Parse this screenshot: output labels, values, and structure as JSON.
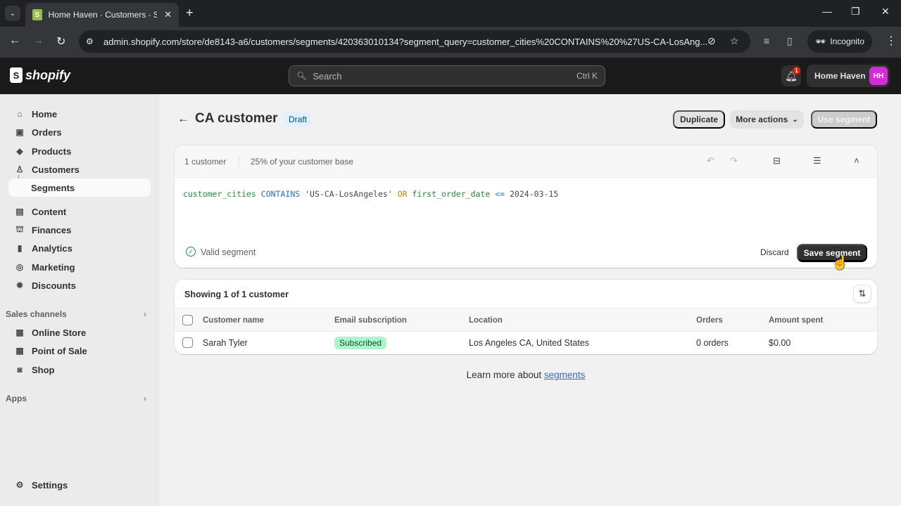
{
  "browser": {
    "tab_title": "Home Haven · Customers · Shopify",
    "url": "admin.shopify.com/store/de8143-a6/customers/segments/420363010134?segment_query=customer_cities%20CONTAINS%20%27US-CA-LosAng...",
    "incognito_label": "Incognito",
    "new_tab": "+",
    "tab_close": "✕"
  },
  "header": {
    "logo_text": "shopify",
    "search_placeholder": "Search",
    "search_shortcut": "Ctrl K",
    "notification_count": "1",
    "store_name": "Home Haven",
    "avatar_initials": "HH",
    "avatar_color": "#d42cd6"
  },
  "sidebar": {
    "items": [
      {
        "label": "Home",
        "icon": "home-icon"
      },
      {
        "label": "Orders",
        "icon": "inbox-icon"
      },
      {
        "label": "Products",
        "icon": "tag-icon"
      },
      {
        "label": "Customers",
        "icon": "person-icon"
      },
      {
        "label": "Segments",
        "icon": "",
        "active": true
      },
      {
        "label": "Content",
        "icon": "content-icon"
      },
      {
        "label": "Finances",
        "icon": "bank-icon"
      },
      {
        "label": "Analytics",
        "icon": "bar-chart-icon"
      },
      {
        "label": "Marketing",
        "icon": "target-icon"
      },
      {
        "label": "Discounts",
        "icon": "discount-icon"
      }
    ],
    "sales_channels_label": "Sales channels",
    "sales_channels": [
      {
        "label": "Online Store",
        "icon": "store-icon"
      },
      {
        "label": "Point of Sale",
        "icon": "pos-icon"
      },
      {
        "label": "Shop",
        "icon": "shop-icon"
      }
    ],
    "apps_label": "Apps",
    "settings_label": "Settings"
  },
  "page": {
    "title": "CA customer",
    "status_badge": "Draft",
    "actions": {
      "duplicate": "Duplicate",
      "more_actions": "More actions",
      "use_segment": "Use segment"
    }
  },
  "editor": {
    "customer_count": "1 customer",
    "base_percentage": "25% of your customer base",
    "query": {
      "field1": "customer_cities",
      "op1": "CONTAINS",
      "value1": "'US-CA-LosAngeles'",
      "logic": "OR",
      "field2": "first_order_date",
      "op2": "<=",
      "value2": "2024-03-15"
    },
    "validation": "Valid segment",
    "discard_label": "Discard",
    "save_label": "Save segment"
  },
  "results": {
    "summary": "Showing 1 of 1 customer",
    "columns": [
      "Customer name",
      "Email subscription",
      "Location",
      "Orders",
      "Amount spent"
    ],
    "rows": [
      {
        "name": "Sarah Tyler",
        "email_subscription": "Subscribed",
        "location": "Los Angeles CA, United States",
        "orders": "0 orders",
        "amount_spent": "$0.00"
      }
    ]
  },
  "footer": {
    "learn_prefix": "Learn more about ",
    "learn_link": "segments"
  }
}
